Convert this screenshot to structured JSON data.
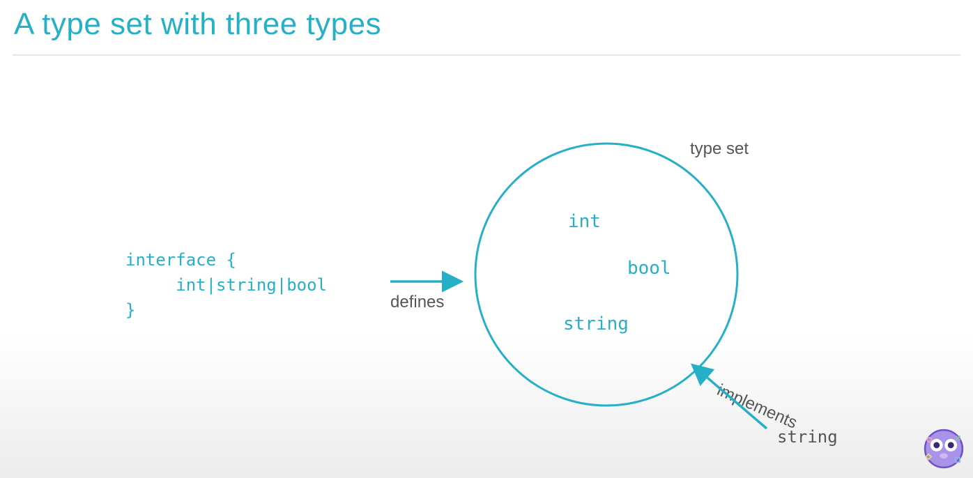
{
  "title": "A type set with three types",
  "code": "interface {\n     int|string|bool\n}",
  "labels": {
    "defines": "defines",
    "typeset": "type set",
    "implements": "implements",
    "external_type": "string"
  },
  "circle_types": {
    "int": "int",
    "bool": "bool",
    "string": "string"
  },
  "colors": {
    "accent": "#26b0c7",
    "text_muted": "#555555"
  }
}
